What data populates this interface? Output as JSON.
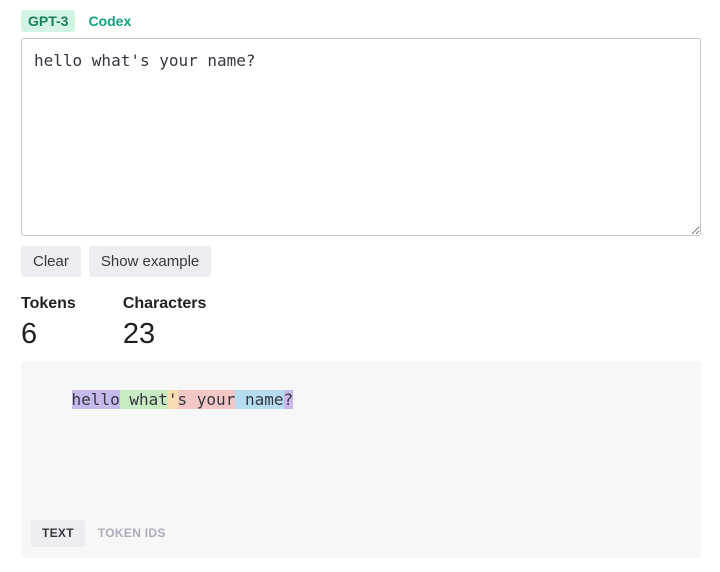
{
  "model_tabs": {
    "gpt3": "GPT-3",
    "codex": "Codex"
  },
  "prompt": {
    "value": "hello what's your name?"
  },
  "buttons": {
    "clear": "Clear",
    "show_example": "Show example"
  },
  "stats": {
    "tokens_label": "Tokens",
    "tokens_value": "6",
    "characters_label": "Characters",
    "characters_value": "23"
  },
  "tokens": [
    {
      "text": "hello",
      "color": "#c9b8ec"
    },
    {
      "text": " what",
      "color": "#c8ebc3"
    },
    {
      "text": "'",
      "color": "#f6ddb1"
    },
    {
      "text": "s",
      "color": "#f3c7c5"
    },
    {
      "text": " your",
      "color": "#f3c7c5"
    },
    {
      "text": " name",
      "color": "#b6dcf1"
    },
    {
      "text": "?",
      "color": "#c9b8ec"
    }
  ],
  "view_toggle": {
    "text": "TEXT",
    "token_ids": "TOKEN IDS"
  }
}
